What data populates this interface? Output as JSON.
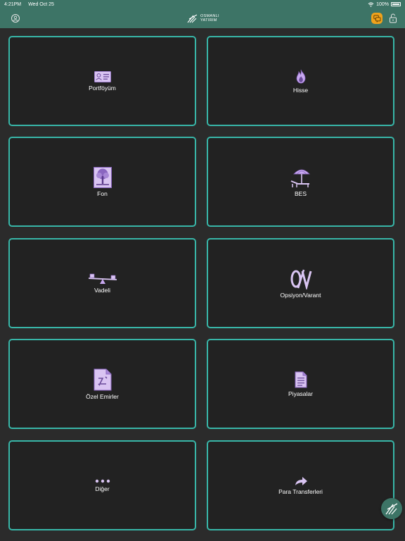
{
  "status_bar": {
    "time": "4:21PM",
    "date": "Wed Oct 25",
    "battery": "100%"
  },
  "header": {
    "logo_line1": "OSMANLI",
    "logo_line2": "YATIRIM"
  },
  "colors": {
    "header_bg": "#3d7466",
    "tile_border": "#38b6a8",
    "tile_bg": "#222222",
    "page_bg": "#2b2b2b",
    "icon_purple": "#c8a8f0",
    "chat_badge": "#f0a21c"
  },
  "tiles": [
    {
      "label": "Portföyüm",
      "icon": "id-card-icon"
    },
    {
      "label": "Hisse",
      "icon": "fire-icon"
    },
    {
      "label": "Fon",
      "icon": "tree-icon"
    },
    {
      "label": "BES",
      "icon": "beach-umbrella-icon"
    },
    {
      "label": "Vadeli",
      "icon": "seesaw-icon"
    },
    {
      "label": "Opsiyon/Varant",
      "icon": "option-warrant-icon"
    },
    {
      "label": "Özel Emirler",
      "icon": "special-order-document-icon"
    },
    {
      "label": "Piyasalar",
      "icon": "document-icon"
    },
    {
      "label": "Diğer",
      "icon": "more-dots-icon"
    },
    {
      "label": "Para Transferleri",
      "icon": "share-arrow-icon"
    }
  ]
}
